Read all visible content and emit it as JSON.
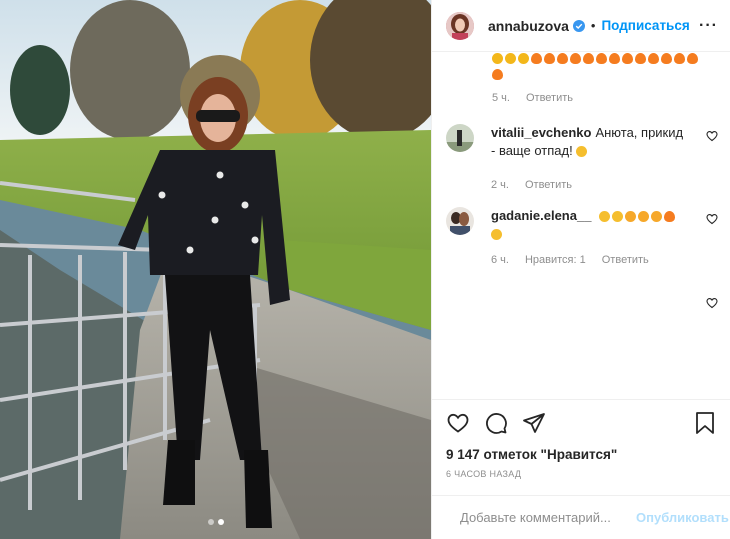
{
  "header": {
    "username": "annabuzova",
    "separator": "•",
    "follow_label": "Подписаться",
    "more_label": "···"
  },
  "caption_tail": {
    "emojis": [
      "star",
      "star",
      "star",
      "flame",
      "flame",
      "flame",
      "flame",
      "flame",
      "flame",
      "flame",
      "flame",
      "flame",
      "flame",
      "flame",
      "flame",
      "flame",
      "flame"
    ],
    "time": "5 ч.",
    "reply_label": "Ответить"
  },
  "comments": [
    {
      "username": "vitalii_evchenko",
      "text": "Анюта, прикид - ваще отпад!",
      "time": "2 ч.",
      "reply_label": "Ответить"
    },
    {
      "username": "gadanie.elena__",
      "text": "",
      "time": "6 ч.",
      "likes_label": "Нравится: 1",
      "reply_label": "Ответить"
    }
  ],
  "likes_count_label": "9 147 отметок \"Нравится\"",
  "time_ago": "6 ЧАСОВ НАЗАД",
  "comment_box": {
    "placeholder": "Добавьте комментарий...",
    "publish_label": "Опубликовать"
  },
  "carousel": {
    "count": 2,
    "active": 2
  },
  "colors": {
    "accent": "#0095f6",
    "publish_disabled": "#b2dffc",
    "muted": "#8e8e8e"
  }
}
